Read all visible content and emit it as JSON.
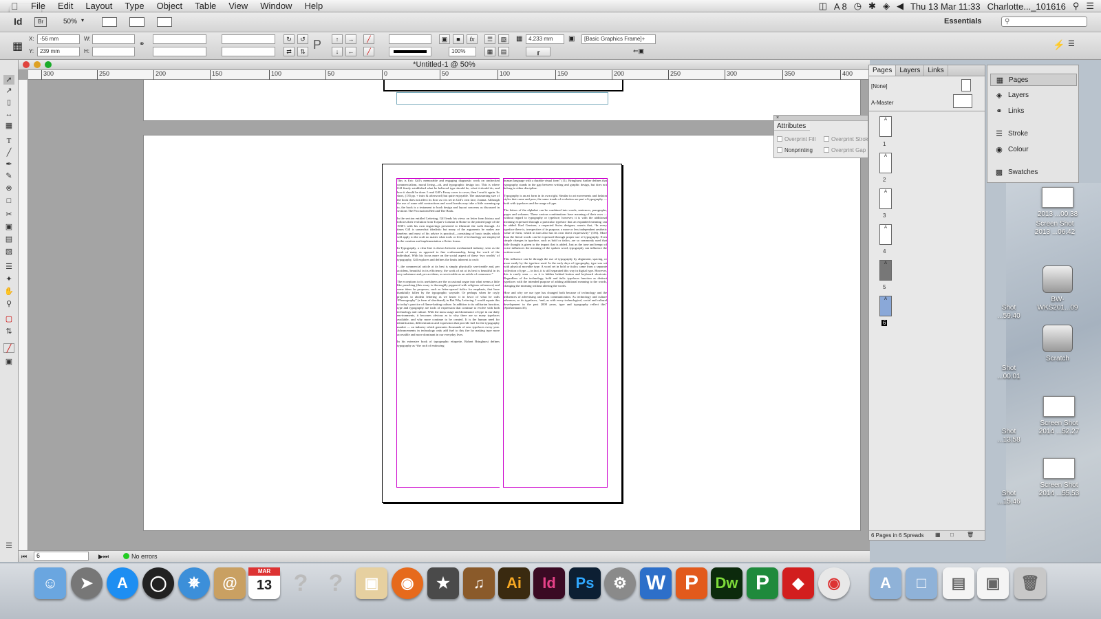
{
  "menubar": {
    "app_name": "InDesign",
    "items": [
      "File",
      "Edit",
      "Layout",
      "Type",
      "Object",
      "Table",
      "View",
      "Window",
      "Help"
    ],
    "right": {
      "adobe_count": "8",
      "datetime": "Thu 13 Mar  11:33",
      "user": "Charlotte..._101616"
    }
  },
  "appbar": {
    "logo": "Id",
    "bridge": "Br",
    "zoom": "50%",
    "workspace": "Essentials"
  },
  "control": {
    "x_label": "X:",
    "x_value": "-56 mm",
    "y_label": "Y:",
    "y_value": "239 mm",
    "w_label": "W:",
    "h_label": "H:",
    "stroke_weight": "4.233 mm",
    "opacity": "100%",
    "object_style": "[Basic Graphics Frame]+"
  },
  "document": {
    "title": "*Untitled-1 @ 50%",
    "ruler_ticks": [
      "300",
      "250",
      "200",
      "150",
      "100",
      "50",
      "0",
      "50",
      "100",
      "150",
      "200",
      "250",
      "300",
      "350",
      "400"
    ],
    "page_nav": "6",
    "status": "No errors",
    "col1": [
      "This is Eric Gill’s memorable and engaging diagnostic work on unchecked commercialism, moral living—oh, and typographic design too. This is where Gill firmly established what he believed type should be, what it should do, and how it should be done. I read Gill’s Essay cover to cover, then I read it again. Its short, (135 pp. + intro & afterword) but quite enjoyable. The unassuming size of the book does not affect its flow as it is set in Gill’s own face, Joanna. Although the use of some odd contractions and word breaks may take a little warming up to, the book is a testament to book design and layout concerns as discussed in sections The Procrustean Bed and The Book.",
      "In the section entitled Lettering, Gill lends his views on letter form history and follows their evolution from Trajan’s Column in Rome to the printed page of the 1930’s with his own engravings presented to illustrate the walk through. At times Gill is somewhat idealistic but many of the arguments he makes are timeless and most of his advice is practical—consisting of basic truths which will apply to the craft no matter what tools or level of technology are employed in the creation and implementation of letter forms.",
      "In Typography, a clear line is drawn between mechanized industry, seen as the work of many as opposed to fine craftsmanship, being the work of the individual. With his focus more on the social aspect of these ‘two worlds’ of typography, Gill explores and defines the limits inherent to each:",
      "“...the commercial article at its best is simply physically serviceable and, per accidens, beautiful in its efficiency; the work of art at its best is beautiful in its very substance and, per accidens, as serviceable as an article of commerce.”",
      "The exceptions to its usefulness are the occasional segue into what seems a little like preaching (this essay is thoroughly peppered with religious references) and some ideas he proposes, such as letter-spaced italics for emphasis, that have thankfully fallen by the typographic wayside. Or perhaps when he coyly proposes to abolish lettering as we know it in favor of what he calls “Phonography” (a form of shorthand), in But Why Lettering. I would equate this to today’s practice of flame-baiting culture. In addition to its utilitarian function, type and typography are tools of expression that continue to evolve with both technology and culture. With the mass usage and dominance of type in our daily environments, it becomes obvious as to why there are so many typefaces available, and why more continue to be created. It is the human need for identification, differentiation and expression that provide fuel for the typography market — an industry which generates thousands of new typefaces every year. Advancements in technology only add fuel to this fire by making type more accessible and more dominant in our everyday lives.",
      "In his extensive book of typographic etiquette, Robert Bringhurst defines typography as “the craft of endowing"
    ],
    "col2": [
      "human language with a durable visual form” (11). Bringhurst further defines that typography stands in the gap between writing and graphic design, but does not belong to either discipline.",
      "Typography is an art form in its own right. Similar to art movements and fashion styles that come and pass, the same trends of evolution are part of typography — both with typefaces and the usage of type.",
      "The letters of the alphabet can be combined into words, sentences, paragraphs, pages and volumes. These various combinations have meaning of their own — without regard to typography or typeface; however, it is with the additional meaning expressed through a particular typeface that an expanded meaning can be added. Karl Gerstner, a respected Swiss designer, asserts that, “In every typeface there is, irrespective of its purpose, a more or less independent aesthetic value of form, which in turn also has its own direct expressivity” (156). More than the literal words can be expressed through proper use of typography. Even simple changes in typeface, such as bold or italics, are so commonly used that little thought is given to the impact that is added. Just as the tone and tempo of voice influences the meaning of the spoken word, typography can influence the written word.",
      "This influence can be through the use of typography by alignment, spacing, or more easily by the typeface used. In the early days of typography, type was set with physical movable type. A word set in bold or italics came from a separate collection of type — in fact, it is still separated this way in digital type. However, this is rarely seen — as it is hidden behind button and keyboard shortcuts. Regardless of the technology, bold and italic typefaces function as distinct typefaces with the intended purpose of adding additional meaning to the words, changing the meaning without altering the words.",
      "How and why we use type has changed both because of technology and the influences of advertising and mass communication. As technology and culture advances, so do typefaces, “and, as with every technological, social and cultural development in the past 2000 years, type and typography reflect this” (Spiekermann 35)."
    ]
  },
  "pages_panel": {
    "tabs": [
      "Pages",
      "Layers",
      "Links"
    ],
    "none_label": "[None]",
    "master_label": "A-Master",
    "pages": [
      "1",
      "2",
      "3",
      "4",
      "5",
      "6"
    ],
    "footer": "6 Pages in 6 Spreads"
  },
  "attributes_panel": {
    "title": "Attributes",
    "overprint_fill": "Overprint Fill",
    "overprint_stroke": "Overprint Strok",
    "nonprinting": "Nonprinting",
    "overprint_gap": "Overprint Gap"
  },
  "dock_panel": {
    "items": [
      "Pages",
      "Layers",
      "Links",
      "Stroke",
      "Colour",
      "Swatches"
    ]
  },
  "desktop": {
    "items": [
      "Screen Shot 2013 ...06.42",
      "BW-WKS201...09",
      "Scratch",
      "Screen Shot 2014 ...52.27",
      "Screen Shot 2014 ...55.53",
      "Shot ...59.40",
      "Shot ...00.01",
      "Shot ...13.58",
      "Shot ...15.46",
      "2013 ...00.38"
    ]
  },
  "macdock": {
    "apps": [
      {
        "name": "Ai",
        "color": "#3a2a10",
        "fg": "#f7a823"
      },
      {
        "name": "Id",
        "color": "#3a0a23",
        "fg": "#e54188"
      },
      {
        "name": "Ps",
        "color": "#0c1f33",
        "fg": "#30a8ff"
      },
      {
        "name": "Dw",
        "color": "#0c2a0c",
        "fg": "#7edb3a"
      }
    ],
    "calendar_day": "13",
    "calendar_month": "MAR"
  }
}
